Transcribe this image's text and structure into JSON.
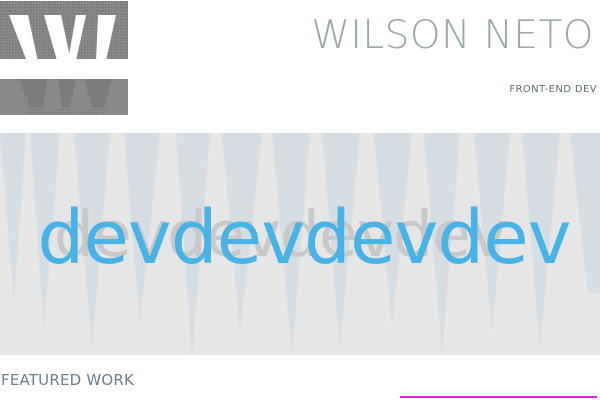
{
  "header": {
    "logo_icon": "w-monogram-logo",
    "title": "WILSON NETO",
    "subtitle": "FRONT-END DEV"
  },
  "hero": {
    "shadow_text": "devdevdevdev",
    "text": "devdevdevdev"
  },
  "featured": {
    "heading": "FEATURED WORK"
  },
  "colors": {
    "accent": "#e51fd2",
    "hero_text": "#4ab3e6",
    "logo": "#7f7f7f"
  }
}
